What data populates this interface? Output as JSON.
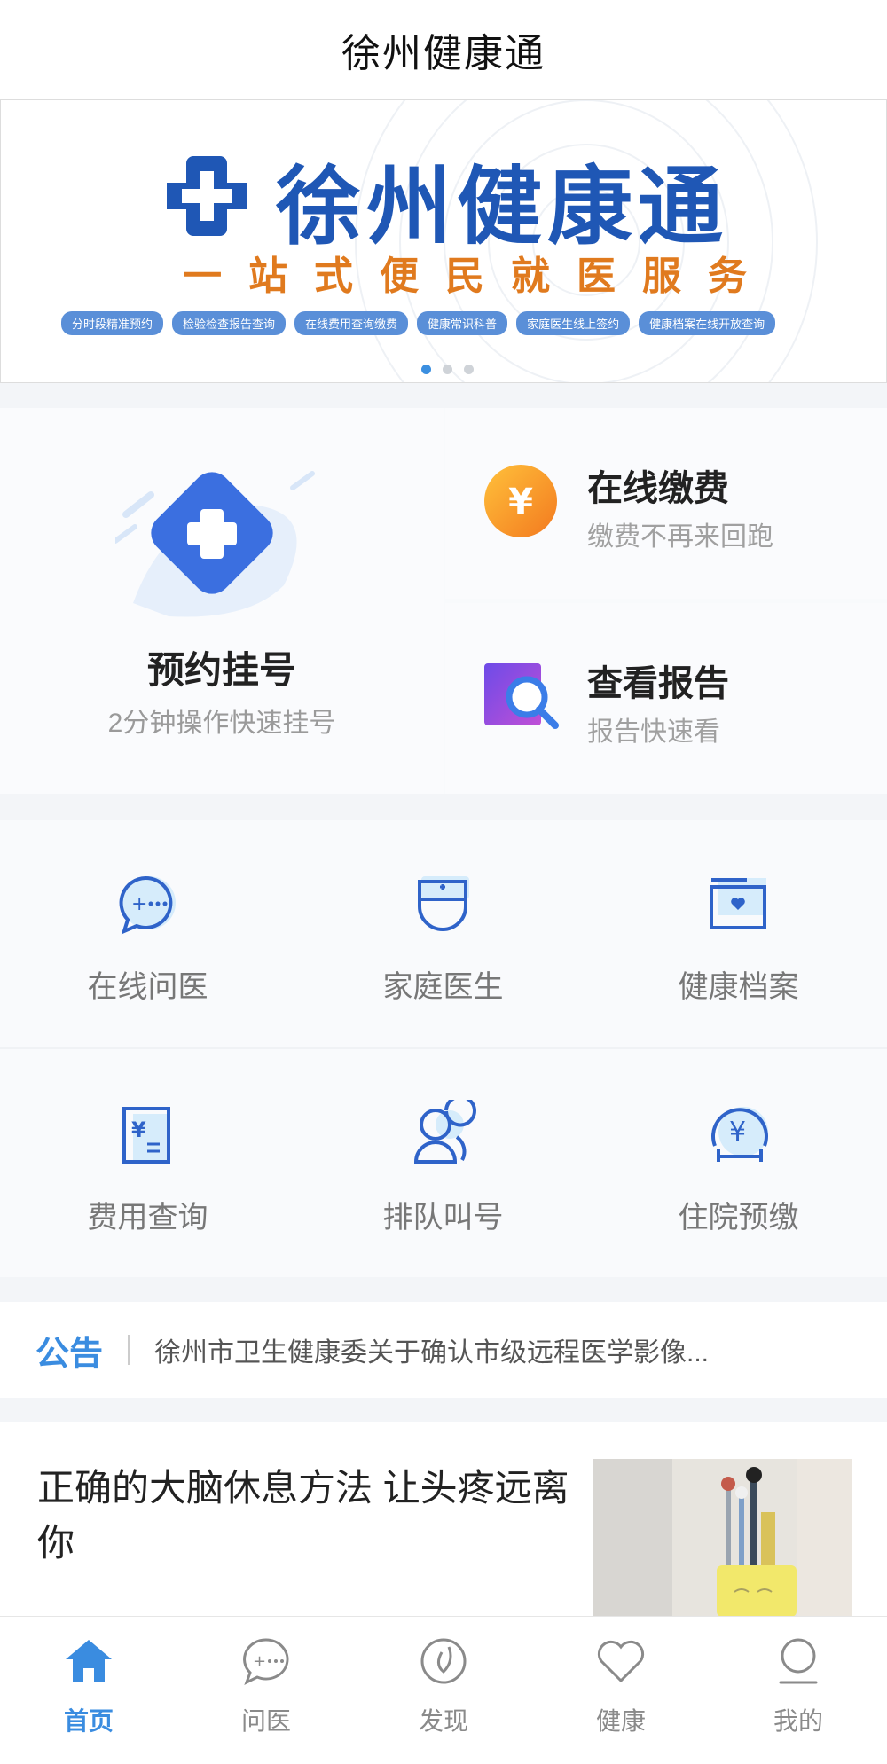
{
  "header": {
    "title": "徐州健康通"
  },
  "banner": {
    "brand": "徐州健康通",
    "slogan": "一站式便民就医服务",
    "tags": [
      "分时段精准预约",
      "检验检查报告查询",
      "在线费用查询缴费",
      "健康常识科普",
      "家庭医生线上签约",
      "健康档案在线开放查询"
    ],
    "slides": 3,
    "active_slide": 1
  },
  "services": {
    "main": {
      "name": "预约挂号",
      "sub": "2分钟操作快速挂号",
      "icon": "hospital-cross-icon"
    },
    "payment": {
      "name": "在线缴费",
      "sub": "缴费不再来回跑",
      "icon": "yuan-coin-icon"
    },
    "report": {
      "name": "查看报告",
      "sub": "报告快速看",
      "icon": "report-search-icon"
    }
  },
  "grid": [
    {
      "label": "在线问医",
      "icon": "chat-bubble-icon"
    },
    {
      "label": "家庭医生",
      "icon": "nurse-cap-icon"
    },
    {
      "label": "健康档案",
      "icon": "folder-heart-icon"
    },
    {
      "label": "费用查询",
      "icon": "yuan-bill-icon"
    },
    {
      "label": "排队叫号",
      "icon": "queue-people-icon"
    },
    {
      "label": "住院预缴",
      "icon": "yuan-bed-icon"
    }
  ],
  "notice": {
    "label": "公告",
    "text": "徐州市卫生健康委关于确认市级远程医学影像..."
  },
  "article": {
    "title": "正确的大脑休息方法 让头疼远离你"
  },
  "tabbar": [
    {
      "label": "首页",
      "icon": "home-icon",
      "active": true
    },
    {
      "label": "问医",
      "icon": "chat-icon",
      "active": false
    },
    {
      "label": "发现",
      "icon": "discover-icon",
      "active": false
    },
    {
      "label": "健康",
      "icon": "heart-icon",
      "active": false
    },
    {
      "label": "我的",
      "icon": "user-icon",
      "active": false
    }
  ],
  "colors": {
    "accent": "#3a8ce0",
    "brand": "#1f57b5",
    "orange": "#e07a1e"
  }
}
